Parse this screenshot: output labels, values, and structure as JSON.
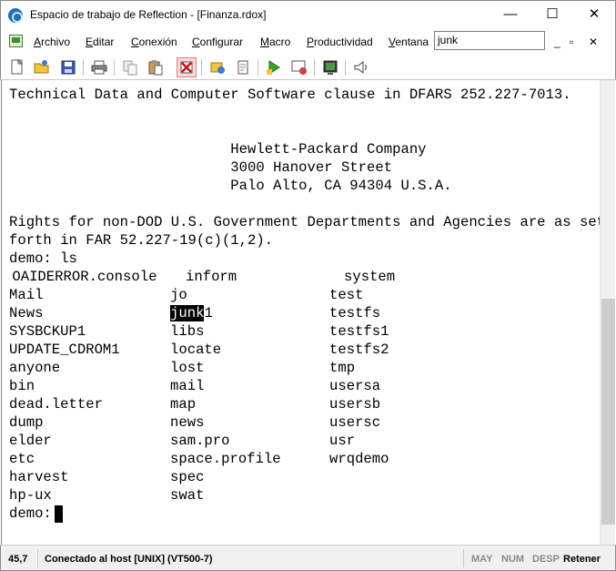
{
  "window": {
    "title": "Espacio de trabajo de Reflection - [Finanza.rdox]",
    "minimize": "—",
    "maximize": "☐",
    "close": "✕"
  },
  "menu": {
    "items": [
      {
        "label": "Archivo",
        "accel": "A",
        "rest": "rchivo"
      },
      {
        "label": "Editar",
        "accel": "E",
        "rest": "ditar"
      },
      {
        "label": "Conexión",
        "accel": "C",
        "rest": "onexión"
      },
      {
        "label": "Configurar",
        "accel": "C",
        "rest": "onfigurar"
      },
      {
        "label": "Macro",
        "accel": "M",
        "rest": "acro"
      },
      {
        "label": "Productividad",
        "accel": "P",
        "rest": "roductividad"
      },
      {
        "label": "Ventana",
        "accel": "V",
        "rest": "entana"
      }
    ],
    "search_value": "junk",
    "mdi_minimize": "_",
    "mdi_restore": "▫",
    "mdi_close": "✕"
  },
  "toolbar": {
    "icons": [
      "new-session-icon",
      "open-folder-icon",
      "save-icon",
      "print-icon",
      "copy-icon",
      "paste-icon",
      "disconnect-icon",
      "settings-icon",
      "document-icon",
      "macro-run-icon",
      "capture-icon",
      "screen-icon",
      "speaker-icon"
    ]
  },
  "terminal": {
    "lines": [
      "Technical Data and Computer Software clause in DFARS 252.227-7013.",
      "",
      "",
      "                          Hewlett-Packard Company",
      "                          3000 Hanover Street",
      "                          Palo Alto, CA 94304 U.S.A.",
      "",
      "Rights for non-DOD U.S. Government Departments and Agencies are as set",
      "forth in FAR 52.227-19(c)(1,2).",
      "demo: ls"
    ],
    "listing": {
      "header": [
        " OAIDERROR.console",
        "inform",
        "system"
      ],
      "col1": [
        "Mail",
        "News",
        "SYSBCKUP1",
        "UPDATE_CDROM1",
        "anyone",
        "bin",
        "dead.letter",
        "dump",
        "elder",
        "etc",
        "harvest",
        "hp-ux"
      ],
      "col2": [
        "jo",
        "junk1",
        "libs",
        "locate",
        "lost",
        "mail",
        "map",
        "news",
        "sam.pro",
        "space.profile",
        "spec",
        "swat"
      ],
      "col3": [
        "test",
        "testfs",
        "testfs1",
        "testfs2",
        "tmp",
        "usersa",
        "usersb",
        "usersc",
        "usr",
        "wrqdemo",
        "",
        ""
      ]
    },
    "highlight_prefix": "junk",
    "highlight_suffix": "1",
    "prompt": "demo: "
  },
  "status": {
    "position": "45,7",
    "connection": "Conectado al host [UNIX] (VT500-7)",
    "may": "MAY",
    "num": "NUM",
    "desp": "DESP",
    "retener": "Retener"
  }
}
